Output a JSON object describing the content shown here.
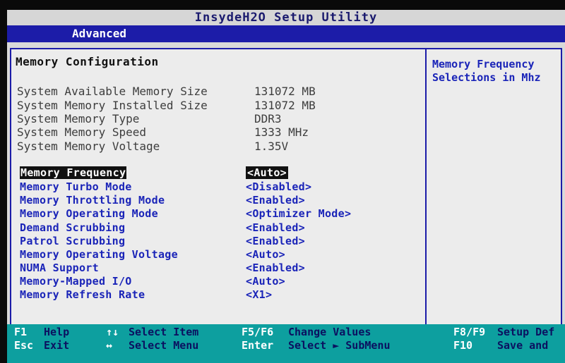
{
  "window": {
    "title": "InsydeH2O Setup Utility"
  },
  "menu": {
    "active_tab": "Advanced"
  },
  "section": {
    "title": "Memory Configuration"
  },
  "info": [
    {
      "label": "System Available Memory Size",
      "value": "131072 MB"
    },
    {
      "label": "System Memory Installed Size",
      "value": "131072 MB"
    },
    {
      "label": "System Memory Type",
      "value": "DDR3"
    },
    {
      "label": "System Memory Speed",
      "value": "1333 MHz"
    },
    {
      "label": "System Memory Voltage",
      "value": "1.35V"
    }
  ],
  "options": [
    {
      "label": "Memory Frequency",
      "value": "<Auto>"
    },
    {
      "label": "Memory Turbo Mode",
      "value": "<Disabled>"
    },
    {
      "label": "Memory Throttling Mode",
      "value": "<Enabled>"
    },
    {
      "label": "Memory Operating Mode",
      "value": "<Optimizer Mode>"
    },
    {
      "label": "Demand Scrubbing",
      "value": "<Enabled>"
    },
    {
      "label": "Patrol Scrubbing",
      "value": "<Enabled>"
    },
    {
      "label": "Memory Operating Voltage",
      "value": "<Auto>"
    },
    {
      "label": "NUMA Support",
      "value": "<Enabled>"
    },
    {
      "label": "Memory-Mapped I/O",
      "value": "<Auto>"
    },
    {
      "label": "Memory Refresh Rate",
      "value": "<X1>"
    }
  ],
  "help": {
    "line1": "Memory Frequency",
    "line2": "Selections in Mhz"
  },
  "footer": {
    "f1": {
      "key": "F1",
      "desc": "Help"
    },
    "esc": {
      "key": "Esc",
      "desc": "Exit"
    },
    "updown": {
      "key": "↑↓",
      "desc": "Select Item"
    },
    "leftright": {
      "key": "↔",
      "desc": "Select Menu"
    },
    "f5f6": {
      "key": "F5/F6",
      "desc": "Change Values"
    },
    "enter": {
      "key": "Enter",
      "desc": "Select ► SubMenu"
    },
    "f8f9": {
      "key": "F8/F9",
      "desc": "Setup Def"
    },
    "f10": {
      "key": "F10",
      "desc": "Save and"
    }
  },
  "colors": {
    "title_bar": "#d6d6d6",
    "menu_bar": "#1c1ca8",
    "option_text": "#1a24b8",
    "footer_bar": "#0d9f9f",
    "selection_bg": "#111111"
  }
}
